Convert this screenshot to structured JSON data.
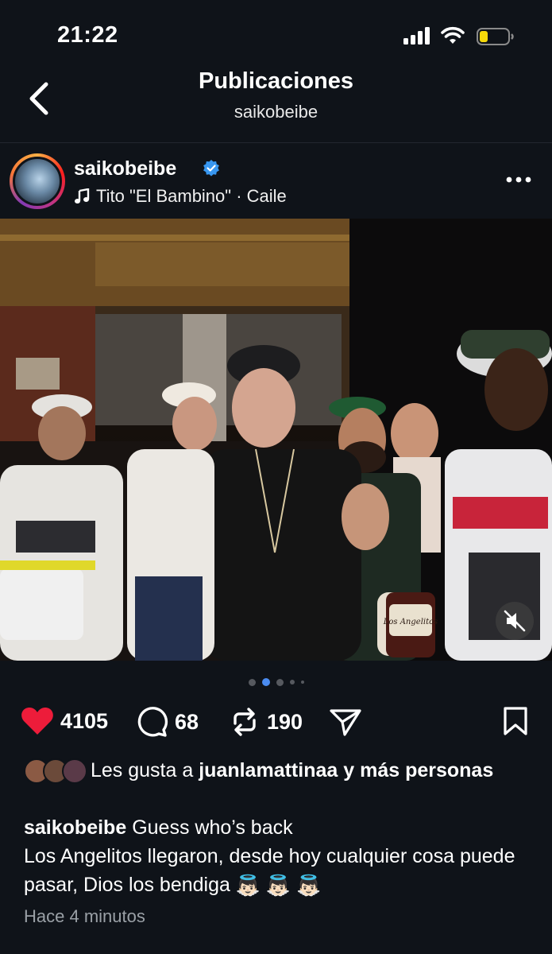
{
  "status_bar": {
    "time": "21:22"
  },
  "header": {
    "title": "Publicaciones",
    "subtitle": "saikobeibe"
  },
  "post": {
    "username": "saikobeibe",
    "music": "Tito \"El Bambino\" · Caile",
    "like_count": "4105",
    "comment_count": "68",
    "repost_count": "190",
    "likes_prefix": "Les gusta a",
    "likes_user": "juanlamattinaa",
    "likes_suffix": "y más personas",
    "caption_user": "saikobeibe",
    "caption_line1": "Guess who’s back",
    "caption_line2": "Los Angelitos llegaron, desde hoy cualquier cosa puede pasar, Dios los bendiga",
    "caption_emoji": "👼🏻 👼🏻 👼🏻",
    "timestamp": "Hace 4 minutos"
  },
  "photo": {
    "bottle_label": "Los Angelitos"
  },
  "colors": {
    "like": "#ed1c3a",
    "accent": "#4a8bf0",
    "verified": "#3897f0",
    "background": "#0f1319"
  }
}
